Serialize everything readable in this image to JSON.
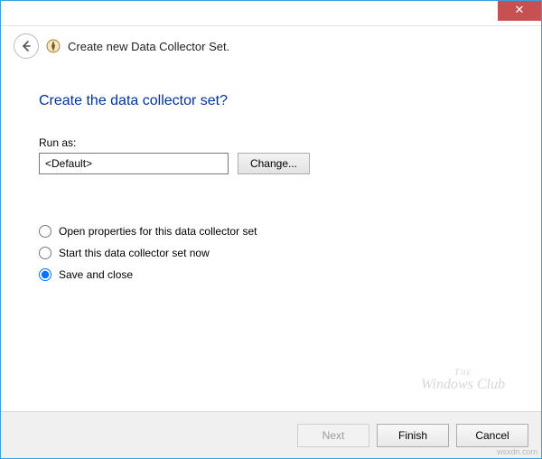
{
  "titlebar": {
    "close_glyph": "✕"
  },
  "header": {
    "wizard_title": "Create new Data Collector Set."
  },
  "content": {
    "question": "Create the data collector set?",
    "runas_label": "Run as:",
    "runas_value": "<Default>",
    "change_label": "Change..."
  },
  "options": [
    {
      "id": "open",
      "label": "Open properties for this data collector set",
      "checked": false
    },
    {
      "id": "start",
      "label": "Start this data collector set now",
      "checked": false
    },
    {
      "id": "save",
      "label": "Save and close",
      "checked": true
    }
  ],
  "footer": {
    "next": "Next",
    "finish": "Finish",
    "cancel": "Cancel"
  },
  "watermark": {
    "line1": "The",
    "line2": "Windows Club"
  },
  "credit": "wsxdn.com"
}
